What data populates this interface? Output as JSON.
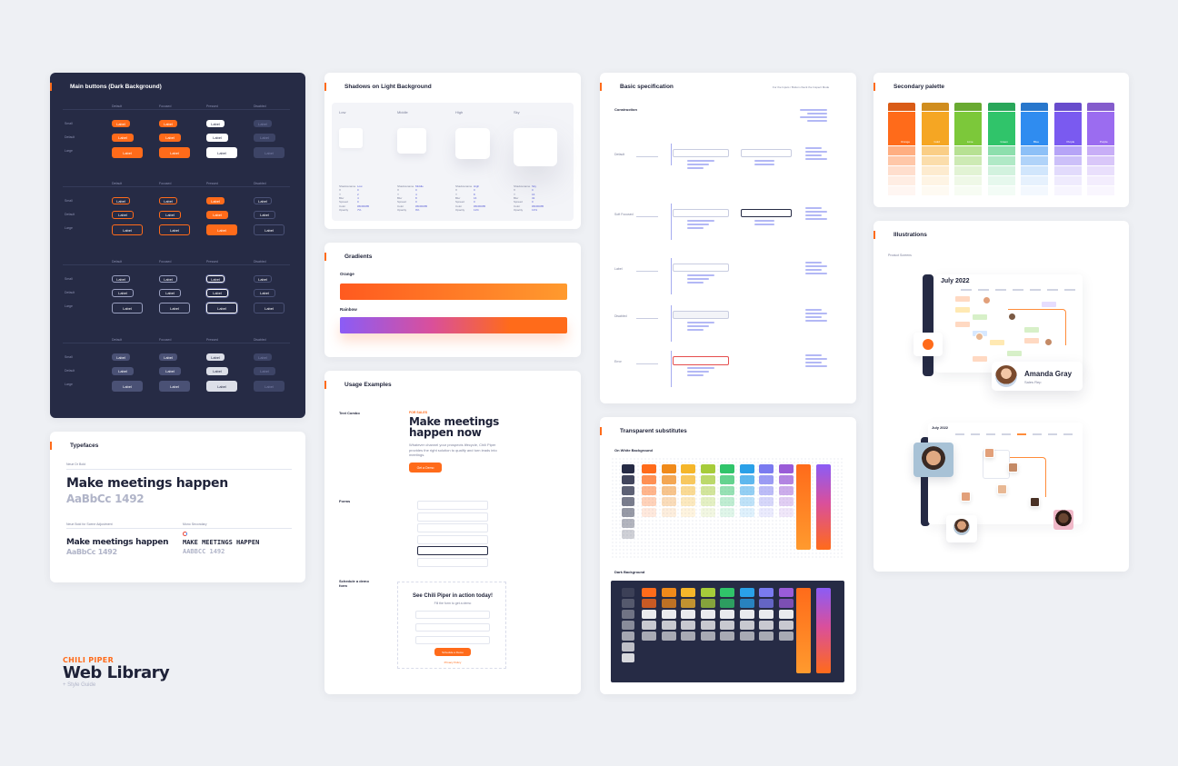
{
  "main_buttons": {
    "title": "Main buttons (Dark Background)",
    "cols": [
      "Default",
      "Focused",
      "Pressed",
      "Disabled"
    ],
    "rows": [
      "Small",
      "Default",
      "Large"
    ],
    "button_label": "Label"
  },
  "shadows": {
    "title": "Shadows on Light Background",
    "levels": [
      "Low",
      "Middle",
      "High",
      "Sky"
    ],
    "meta_keys": [
      "Shadowname",
      "X",
      "Y",
      "Blur",
      "Spread",
      "Color",
      "Opacity"
    ],
    "meta_vals": [
      [
        "Low",
        "0",
        "2",
        "4",
        "0",
        "#6D6D8B",
        "7%"
      ],
      [
        "Middle",
        "0",
        "4",
        "8",
        "0",
        "#6D6D8B",
        "9%"
      ],
      [
        "High",
        "0",
        "8",
        "16",
        "0",
        "#6D6D8B",
        "11%"
      ],
      [
        "Sky",
        "0",
        "16",
        "32",
        "0",
        "#6D6D8B",
        "13%"
      ]
    ]
  },
  "gradients": {
    "title": "Gradients",
    "orange_label": "Orange",
    "rainbow_label": "Rainbow"
  },
  "basic_spec": {
    "title": "Basic specification",
    "subtitle": "Construction",
    "note": "For the Inputs / Button check the Inspect Mode",
    "states": [
      "Default",
      "Soft Focused",
      "Label",
      "Disabled",
      "Error"
    ]
  },
  "secondary": {
    "title": "Secondary palette",
    "names": [
      "Orange",
      "Gold",
      "Lime",
      "Green",
      "Blue",
      "Purple",
      "Purple"
    ]
  },
  "typefaces": {
    "title": "Typefaces",
    "primary_label": "Neue Dr Bold",
    "headline": "Make meetings happen",
    "sample": "AaBbCc 1492",
    "secondary_label": "Neue Bold for Scene Adjustment",
    "sub_headline": "Make meetings happen",
    "sub_sample": "AaBbCc 1492",
    "mono_label": "Mono Secondary",
    "mono_headline": "MAKE MEETINGS HAPPEN",
    "mono_sample": "AABBCC 1492"
  },
  "usage": {
    "title": "Usage Examples",
    "text_combo": "Text Combo",
    "eyebrow": "FOR SALES",
    "headline": "Make meetings happen now",
    "body": "Whatever channel your prospects lifecycle, Chili Piper provides the right solution to qualify and turn leads into meetings.",
    "cta": "Get a Demo",
    "forms_label": "Forms",
    "schedule_label": "Schedule a demo form",
    "schedule_title": "See Chili Piper in action today!",
    "schedule_sub": "Fill the form to get a demo",
    "schedule_cta": "Schedule a Demo",
    "privacy": "Privacy Policy"
  },
  "transparent": {
    "title": "Transparent substitutes",
    "on_white": "On White Background",
    "dark": "Dark Background"
  },
  "illustrations": {
    "title": "Illustrations",
    "sub": "Product Screens",
    "month": "July 2022",
    "person_name": "Amanda Gray",
    "person_role": "Sales Rep",
    "month2": "July 2022"
  },
  "brand": {
    "logo": "CHILI PIPER",
    "title": "Web Library",
    "subtitle": "+ Style Guide"
  },
  "colors": {
    "orange": "#ff6b1a",
    "navy": "#262b45",
    "purple": "#8b5cf6"
  }
}
